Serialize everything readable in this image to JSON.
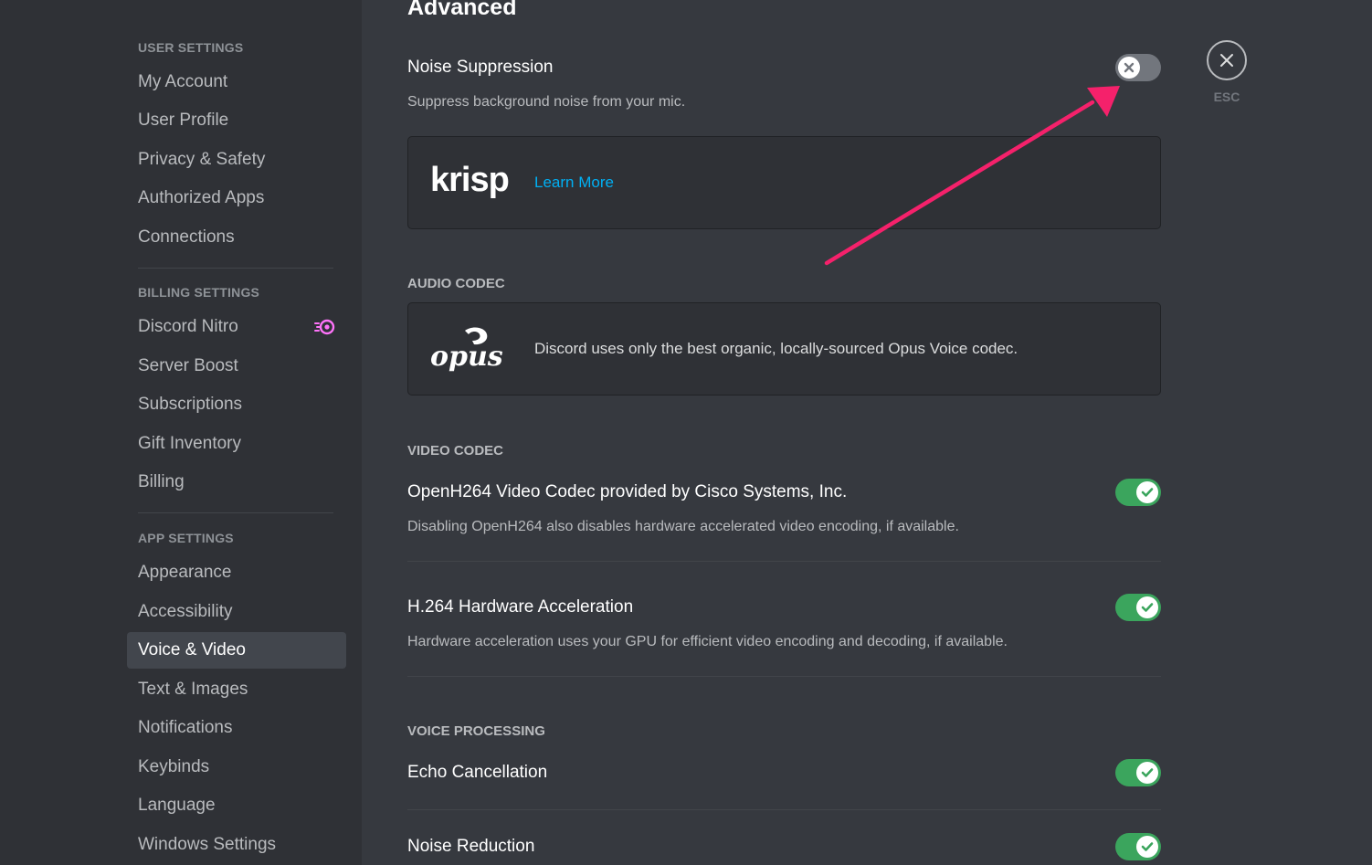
{
  "sidebar": {
    "user_settings_header": "USER SETTINGS",
    "user_items": [
      "My Account",
      "User Profile",
      "Privacy & Safety",
      "Authorized Apps",
      "Connections"
    ],
    "billing_settings_header": "BILLING SETTINGS",
    "billing_items": [
      "Discord Nitro",
      "Server Boost",
      "Subscriptions",
      "Gift Inventory",
      "Billing"
    ],
    "app_settings_header": "APP SETTINGS",
    "app_items": [
      "Appearance",
      "Accessibility",
      "Voice & Video",
      "Text & Images",
      "Notifications",
      "Keybinds",
      "Language",
      "Windows Settings"
    ],
    "selected_item": "Voice & Video"
  },
  "main": {
    "page_title": "Advanced",
    "noise_suppression": {
      "title": "Noise Suppression",
      "description": "Suppress background noise from your mic.",
      "enabled": false
    },
    "krisp": {
      "logo": "krisp",
      "learn_more": "Learn More"
    },
    "audio_codec": {
      "header": "AUDIO CODEC",
      "logo": "opus",
      "text": "Discord uses only the best organic, locally-sourced Opus Voice codec."
    },
    "video_codec": {
      "header": "VIDEO CODEC",
      "openh264": {
        "title": "OpenH264 Video Codec provided by Cisco Systems, Inc.",
        "description": "Disabling OpenH264 also disables hardware accelerated video encoding, if available.",
        "enabled": true
      },
      "h264_hw": {
        "title": "H.264 Hardware Acceleration",
        "description": "Hardware acceleration uses your GPU for efficient video encoding and decoding, if available.",
        "enabled": true
      }
    },
    "voice_processing": {
      "header": "VOICE PROCESSING",
      "echo_cancellation": {
        "title": "Echo Cancellation",
        "enabled": true
      },
      "noise_reduction": {
        "title": "Noise Reduction",
        "enabled": true
      }
    },
    "close": {
      "label": "ESC"
    }
  },
  "colors": {
    "sidebar_bg": "#2f3136",
    "main_bg": "#36393f",
    "toggle_on": "#3ba55d",
    "toggle_off": "#72767d",
    "link": "#00b0f4",
    "annotation_arrow": "#f5216b",
    "nitro": "#ff73fa"
  }
}
